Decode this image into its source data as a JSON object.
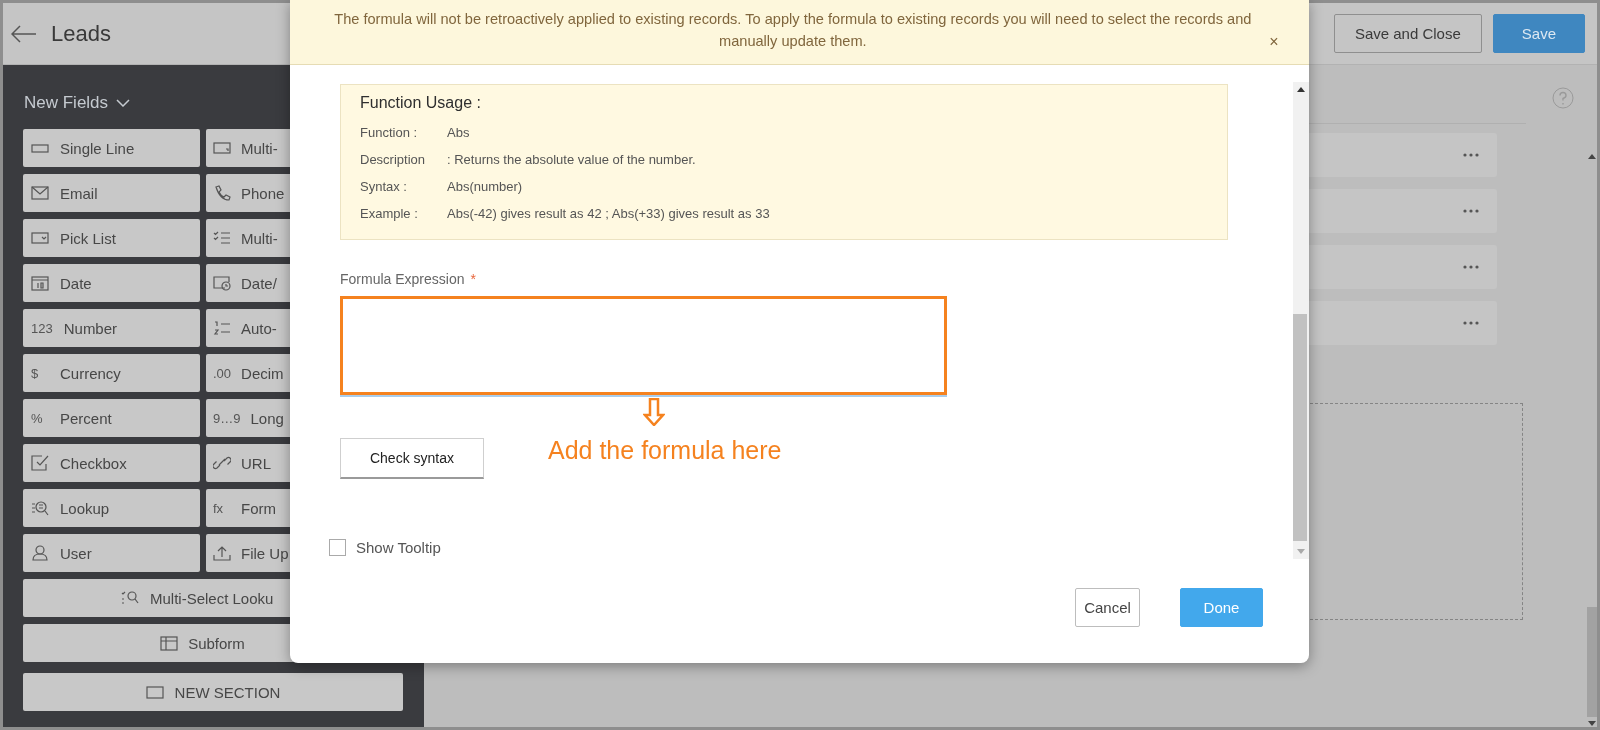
{
  "header": {
    "title": "Leads",
    "buttons": [
      {
        "label": "Save and Close",
        "kind": "secondary"
      },
      {
        "label": "Save",
        "kind": "primary"
      }
    ]
  },
  "sidebar": {
    "heading": "New Fields",
    "tiles": [
      {
        "label": "Single Line"
      },
      {
        "label": "Multi-"
      },
      {
        "label": "Email"
      },
      {
        "label": "Phone"
      },
      {
        "label": "Pick List"
      },
      {
        "label": "Multi-"
      },
      {
        "label": "Date"
      },
      {
        "label": "Date/"
      },
      {
        "label": "Number",
        "glyph": "123"
      },
      {
        "label": "Auto-"
      },
      {
        "label": "Currency",
        "glyph": "$"
      },
      {
        "label": "Decim",
        "glyph": ".00"
      },
      {
        "label": "Percent",
        "glyph": "%"
      },
      {
        "label": "Long",
        "glyph": "9…9"
      },
      {
        "label": "Checkbox"
      },
      {
        "label": "URL"
      },
      {
        "label": "Lookup"
      },
      {
        "label": "Form",
        "glyph": "fx"
      },
      {
        "label": "User"
      },
      {
        "label": "File Up"
      }
    ],
    "wide_tiles": [
      {
        "label": "Multi-Select Looku"
      },
      {
        "label": "Subform"
      }
    ],
    "section_button": "NEW SECTION"
  },
  "modal": {
    "notice": "The formula will not be retroactively applied to existing records. To apply the formula to existing records you will need to select the records and manually update them.",
    "notice_close": "×",
    "function_usage": {
      "title": "Function Usage :",
      "rows": [
        {
          "label": "Function :",
          "value": "Abs"
        },
        {
          "label": "Description",
          "value": ": Returns the absolute value of the number."
        },
        {
          "label": "Syntax :",
          "value": "Abs(number)"
        },
        {
          "label": "Example :",
          "value": "Abs(-42) gives result as 42 ; Abs(+33) gives result as 33"
        }
      ]
    },
    "formula_label": "Formula Expression",
    "required_mark": "*",
    "annotation": "Add the formula here",
    "check_button": "Check syntax",
    "tooltip": {
      "label": "Show Tooltip",
      "checked": false
    },
    "buttons": [
      {
        "label": "Cancel",
        "kind": "secondary"
      },
      {
        "label": "Done",
        "kind": "primary"
      }
    ]
  }
}
